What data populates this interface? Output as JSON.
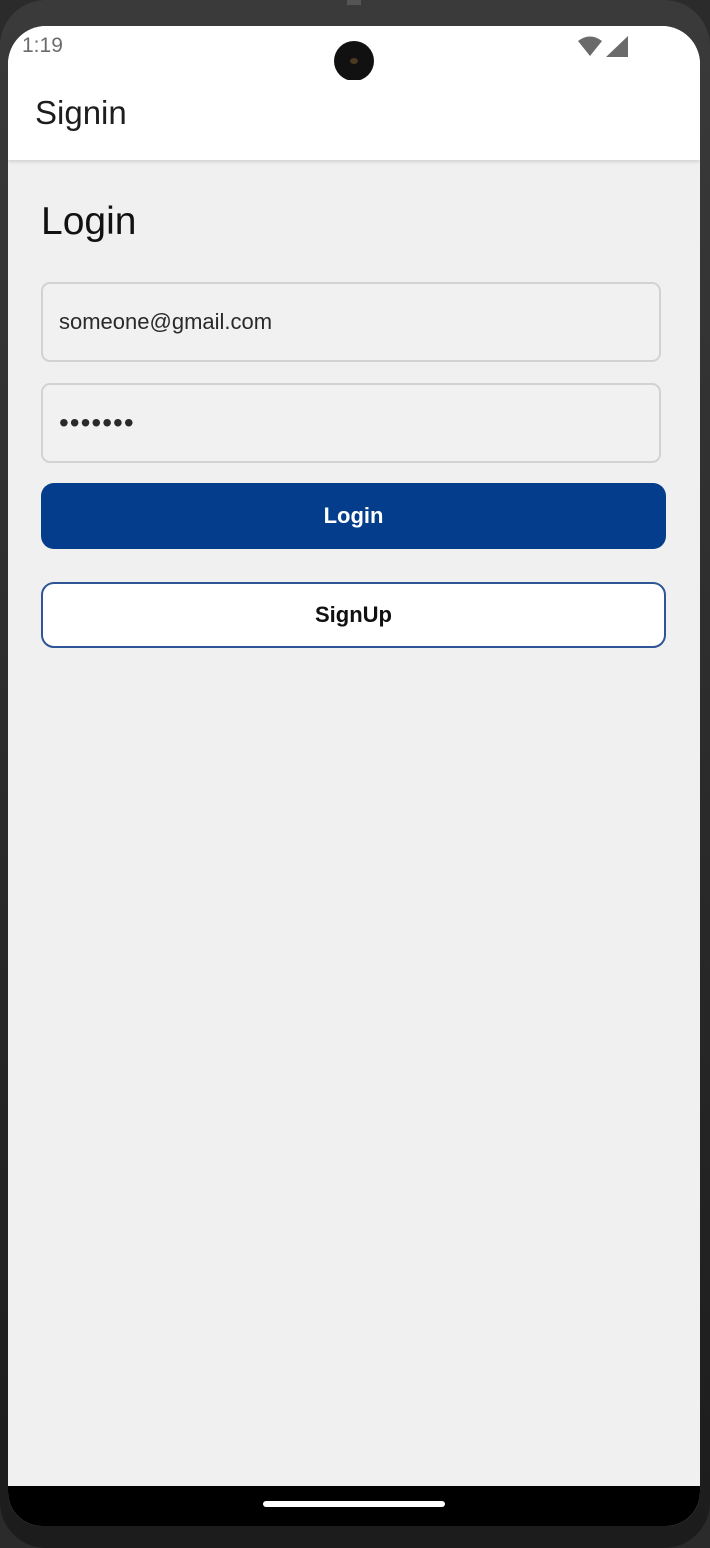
{
  "status_bar": {
    "time": "1:19",
    "icons": [
      "wifi-icon",
      "cellular-signal-icon"
    ]
  },
  "app_bar": {
    "title": "Signin"
  },
  "login_form": {
    "heading": "Login",
    "email_value": "someone@gmail.com",
    "password_value": "•••••••",
    "login_button_label": "Login",
    "signup_button_label": "SignUp"
  },
  "colors": {
    "primary": "#043d8c",
    "background": "#f0f0f0",
    "app_bar": "#ffffff",
    "outline": "#2f5596"
  }
}
